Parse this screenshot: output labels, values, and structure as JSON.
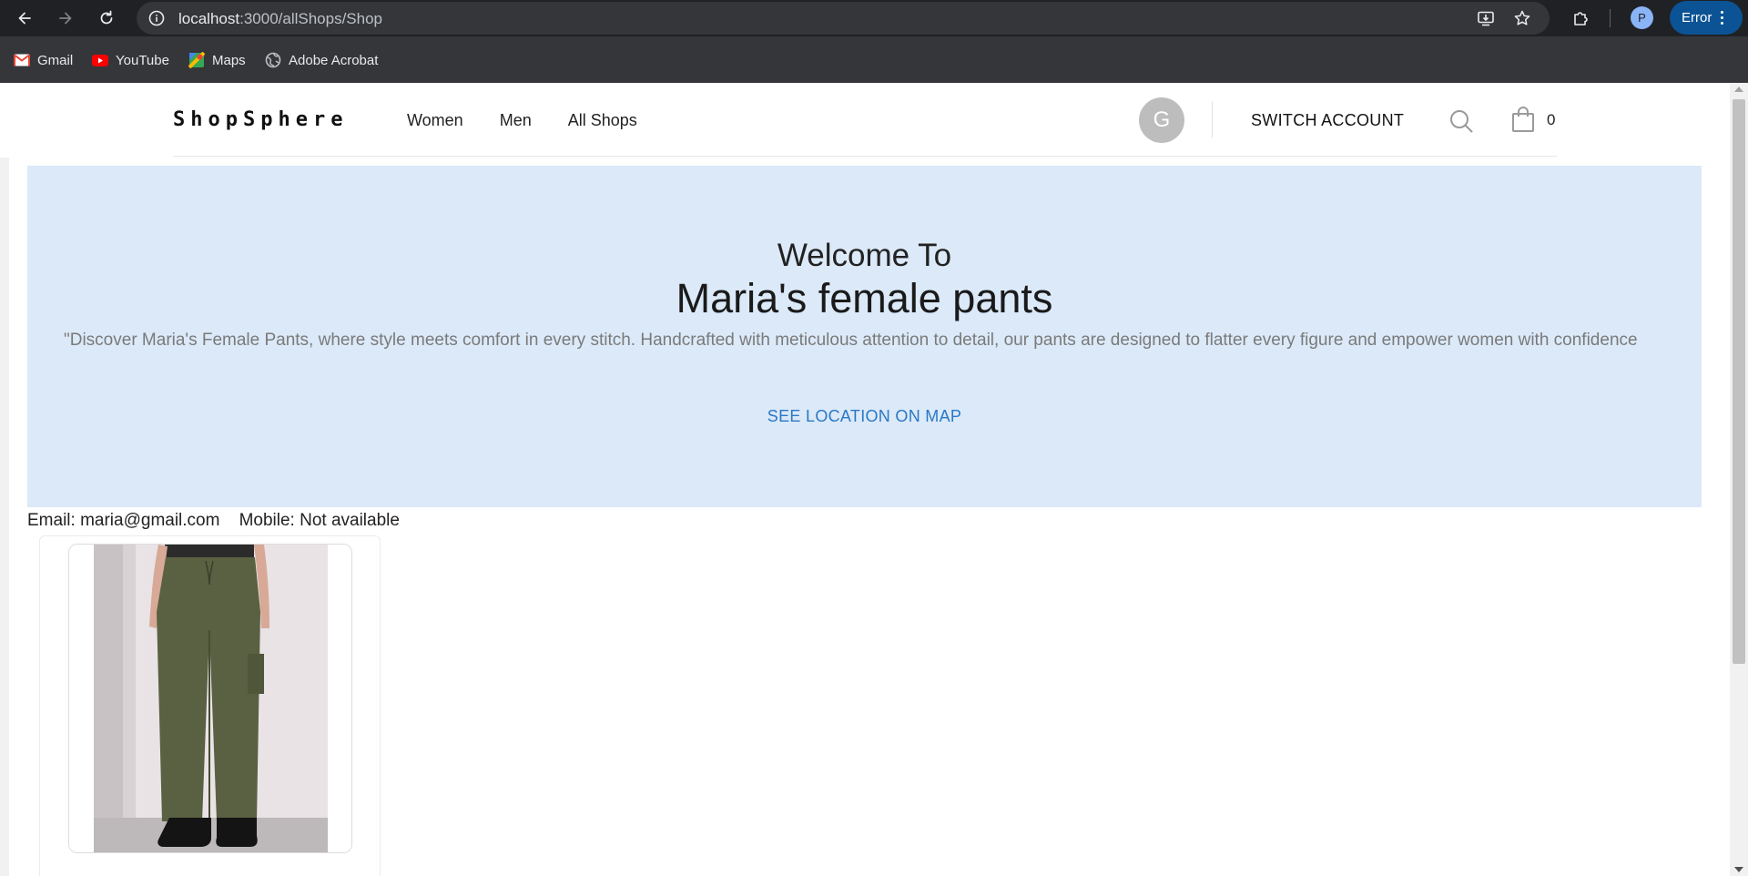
{
  "browser": {
    "url_host": "localhost",
    "url_path": ":3000/allShops/Shop",
    "profile_initial": "P",
    "error_label": "Error",
    "bookmarks": [
      {
        "label": "Gmail",
        "icon": "gmail-icon"
      },
      {
        "label": "YouTube",
        "icon": "youtube-icon"
      },
      {
        "label": "Maps",
        "icon": "maps-icon"
      },
      {
        "label": "Adobe Acrobat",
        "icon": "globe-icon"
      }
    ]
  },
  "header": {
    "logo": "ShopSphere",
    "nav": [
      "Women",
      "Men",
      "All Shops"
    ],
    "avatar_initial": "G",
    "switch_account": "SWITCH ACCOUNT",
    "cart_count": "0"
  },
  "hero": {
    "welcome": "Welcome To",
    "shop_name": "Maria's female pants",
    "description": "\"Discover Maria's Female Pants, where style meets comfort in every stitch. Handcrafted with meticulous attention to detail, our pants are designed to flatter every figure and empower women with confidence",
    "map_link": "SEE LOCATION ON MAP"
  },
  "contact": {
    "email_label": "Email:",
    "email": "maria@gmail.com",
    "mobile_label": "Mobile:",
    "mobile": "Not available"
  },
  "colors": {
    "hero_bg": "#dbe9f8",
    "link": "#2b78c5",
    "error_chip": "#0b5394"
  }
}
